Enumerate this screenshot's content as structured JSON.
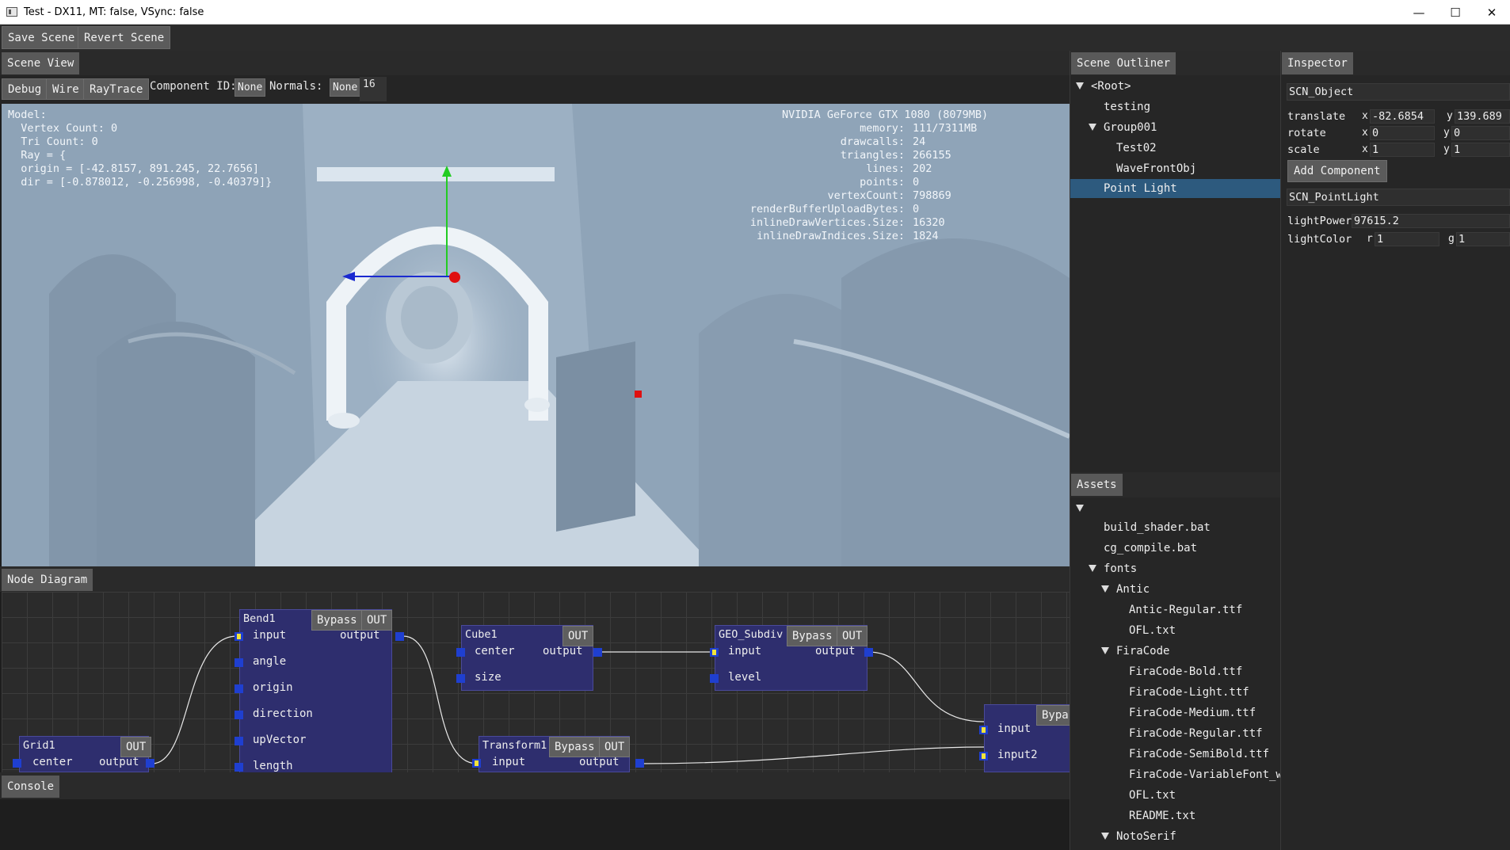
{
  "window": {
    "title": "Test - DX11, MT: false, VSync: false",
    "min_icon": "minimize-icon",
    "max_icon": "maximize-icon",
    "close_icon": "close-icon"
  },
  "toolbar": {
    "save": "Save Scene",
    "revert": "Revert Scene"
  },
  "scene_view": {
    "tab": "Scene View",
    "debug": "Debug",
    "wire": "Wire",
    "raytrace": "RayTrace",
    "component_id_label": "Component ID:",
    "component_id_value": "None",
    "normals_label": "Normals:",
    "normals_value": "None",
    "normals_size": "16",
    "model_info": {
      "l1": "Model:",
      "l2": "  Vertex Count: 0",
      "l3": "  Tri Count: 0",
      "l4": "  Ray = {",
      "l5": "  origin = [-42.8157, 891.245, 22.7656]",
      "l6": "  dir = [-0.878012, -0.256998, -0.40379]}"
    },
    "gpu": "NVIDIA GeForce GTX 1080 (8079MB)",
    "stats": [
      {
        "k": "memory:",
        "v": "111/7311MB"
      },
      {
        "k": "drawcalls:",
        "v": "24"
      },
      {
        "k": "triangles:",
        "v": "266155"
      },
      {
        "k": "lines:",
        "v": "202"
      },
      {
        "k": "points:",
        "v": "0"
      },
      {
        "k": "vertexCount:",
        "v": "798869"
      },
      {
        "k": "renderBufferUploadBytes:",
        "v": "0"
      },
      {
        "k": "inlineDrawVertices.Size:",
        "v": "16320"
      },
      {
        "k": "inlineDrawIndices.Size:",
        "v": "1824"
      }
    ]
  },
  "node_diagram": {
    "tab": "Node Diagram",
    "bypass": "Bypass",
    "out": "OUT",
    "nodes": {
      "bend1": {
        "name": "Bend1",
        "inputs": [
          "input",
          "angle",
          "origin",
          "direction",
          "upVector",
          "length"
        ],
        "output": "output"
      },
      "cube1": {
        "name": "Cube1",
        "inputs": [
          "center",
          "size"
        ],
        "output": "output"
      },
      "geo": {
        "name": "GEO_Subdiv",
        "inputs": [
          "input",
          "level"
        ],
        "output": "output"
      },
      "grid1": {
        "name": "Grid1",
        "inputs": [
          "center"
        ],
        "output": "output"
      },
      "transform1": {
        "name": "Transform1",
        "inputs": [
          "input"
        ],
        "output": "output"
      },
      "merge": {
        "inputs": [
          "input",
          "input2"
        ],
        "bypass": "Bypas"
      }
    }
  },
  "console": {
    "tab": "Console"
  },
  "outliner": {
    "tab": "Scene Outliner",
    "items": [
      "<Root>",
      "testing",
      "Group001",
      "Test02",
      "WaveFrontObj",
      "Point Light"
    ]
  },
  "inspector": {
    "tab": "Inspector",
    "object": "SCN_Object",
    "translate": {
      "label": "translate",
      "x_label": "x",
      "x": "-82.6854",
      "y_label": "y",
      "y": "139.689"
    },
    "rotate": {
      "label": "rotate",
      "x_label": "x",
      "x": "0",
      "y_label": "y",
      "y": "0"
    },
    "scale": {
      "label": "scale",
      "x_label": "x",
      "x": "1",
      "y_label": "y",
      "y": "1"
    },
    "add_component": "Add Component",
    "component": "SCN_PointLight",
    "light_power": {
      "label": "lightPower",
      "value": "97615.2"
    },
    "light_color": {
      "label": "lightColor",
      "r_label": "r",
      "r": "1",
      "g_label": "g",
      "g": "1"
    }
  },
  "assets": {
    "tab": "Assets",
    "items": [
      "build_shader.bat",
      "cg_compile.bat",
      "fonts",
      "Antic",
      "Antic-Regular.ttf",
      "OFL.txt",
      "FiraCode",
      "FiraCode-Bold.ttf",
      "FiraCode-Light.ttf",
      "FiraCode-Medium.ttf",
      "FiraCode-Regular.ttf",
      "FiraCode-SemiBold.ttf",
      "FiraCode-VariableFont_wg",
      "OFL.txt",
      "README.txt",
      "NotoSerif"
    ]
  }
}
